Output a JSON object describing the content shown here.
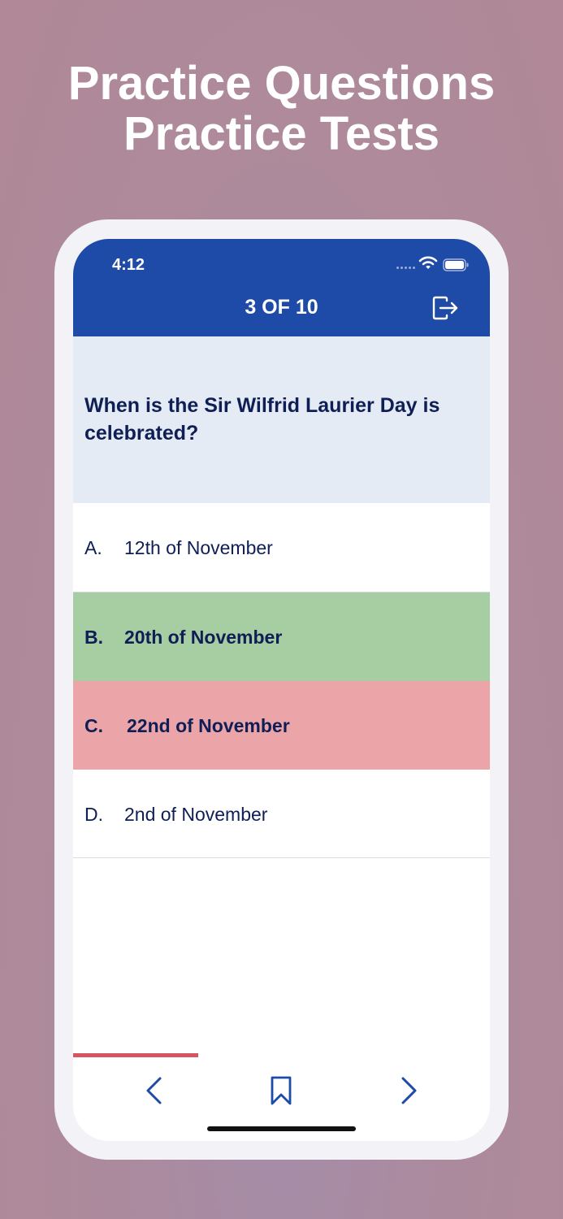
{
  "promo": {
    "line1": "Practice Questions",
    "line2": "Practice Tests"
  },
  "status_bar": {
    "time": "4:12"
  },
  "header": {
    "title": "3 OF 10",
    "exit_icon": "exit-icon"
  },
  "question": {
    "text": "When is the Sir Wilfrid Laurier Day is celebrated?"
  },
  "answers": [
    {
      "letter": "A.",
      "text": "12th of November",
      "state": "neutral"
    },
    {
      "letter": "B.",
      "text": "20th of November",
      "state": "correct"
    },
    {
      "letter": "C.",
      "text": "22nd of November",
      "state": "incorrect"
    },
    {
      "letter": "D.",
      "text": "2nd of November",
      "state": "neutral"
    }
  ],
  "progress": {
    "fraction": 0.3,
    "color": "#d65560"
  },
  "bottom_nav": {
    "prev_icon": "chevron-left-icon",
    "bookmark_icon": "bookmark-icon",
    "next_icon": "chevron-right-icon"
  },
  "colors": {
    "header": "#1f4ba8",
    "correct": "#a7cda2",
    "incorrect": "#eba5a9",
    "question_bg": "#e4ebf4",
    "text": "#0f1f55"
  }
}
